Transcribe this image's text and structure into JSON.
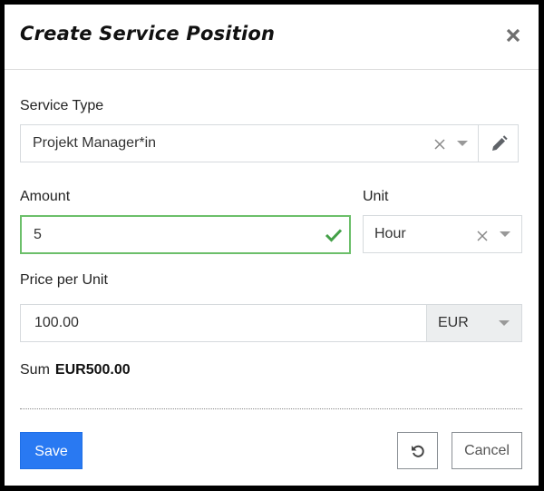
{
  "dialog": {
    "title": "Create Service Position",
    "close_icon": "close-icon"
  },
  "service_type": {
    "label": "Service Type",
    "value": "Projekt Manager*in",
    "clear_icon": "clear-icon",
    "dropdown_icon": "chevron-down-icon",
    "edit_icon": "pencil-icon"
  },
  "amount": {
    "label": "Amount",
    "value": "5",
    "valid_icon": "check-icon",
    "valid_color": "#4caf50"
  },
  "unit": {
    "label": "Unit",
    "value": "Hour",
    "clear_icon": "clear-icon",
    "dropdown_icon": "chevron-down-icon"
  },
  "price": {
    "label": "Price per Unit",
    "value": "100.00",
    "currency": "EUR",
    "dropdown_icon": "chevron-down-icon"
  },
  "sum": {
    "label": "Sum",
    "value": "EUR500.00"
  },
  "footer": {
    "save_label": "Save",
    "reset_icon": "reset-icon",
    "cancel_label": "Cancel",
    "primary_color": "#2979f2"
  }
}
